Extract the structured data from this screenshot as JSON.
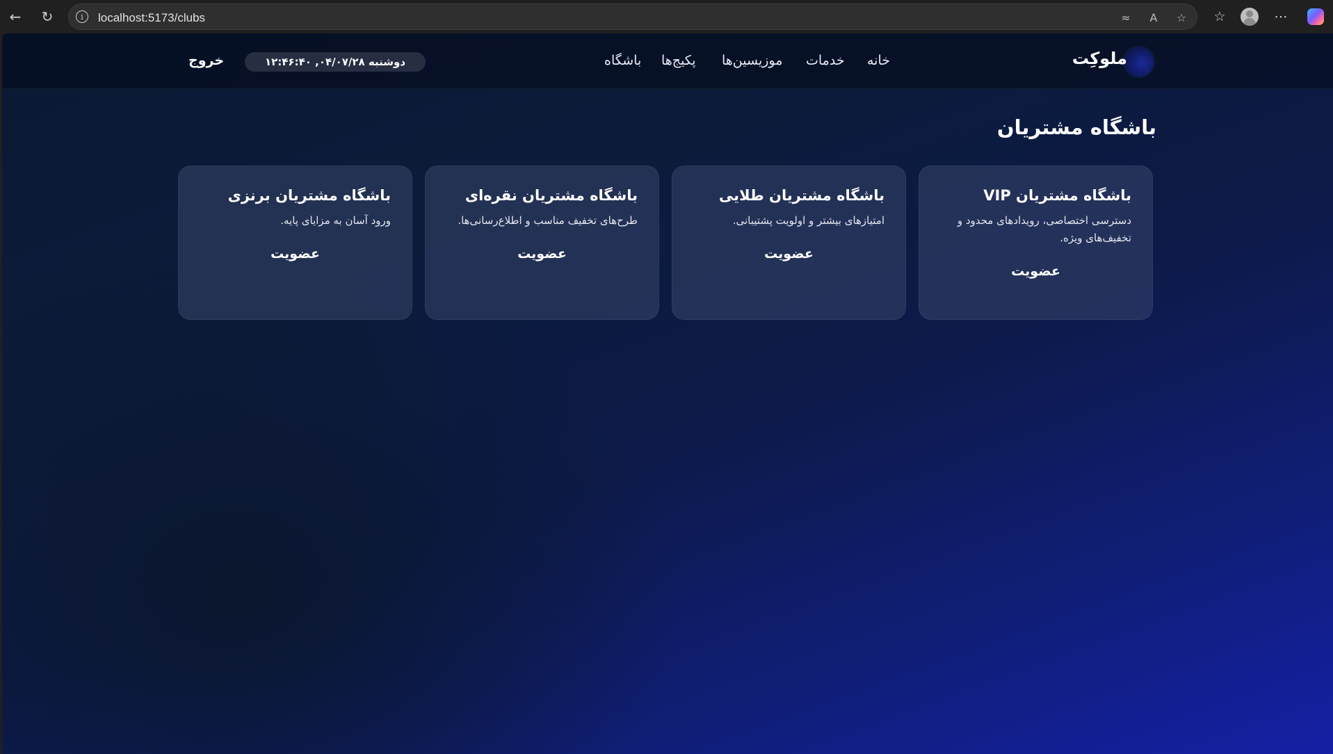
{
  "browser": {
    "url": "localhost:5173/clubs"
  },
  "header": {
    "logo": "ملوکِت",
    "nav": [
      "خانه",
      "خدمات",
      "موزیسین‌ها",
      "پکیج‌ها",
      "باشگاه"
    ],
    "datetime": "دوشنبه ۰۴/۰۷/۲۸, ۱۲:۴۶:۴۰",
    "logout": "خروج"
  },
  "main": {
    "title": "باشگاه مشتریان",
    "cards": [
      {
        "title": "باشگاه مشتریان VIP",
        "description": "دسترسی اختصاصی، رویدادهای محدود و تخفیف‌های ویژه.",
        "action": "عضویت"
      },
      {
        "title": "باشگاه مشتریان طلایی",
        "description": "امتیازهای بیشتر و اولویت پشتیبانی.",
        "action": "عضویت"
      },
      {
        "title": "باشگاه مشتریان نقره‌ای",
        "description": "طرح‌های تخفیف مناسب و اطلاع‌رسانی‌ها.",
        "action": "عضویت"
      },
      {
        "title": "باشگاه مشتریان برنزی",
        "description": "ورود آسان به مزایای پایه.",
        "action": "عضویت"
      }
    ]
  }
}
